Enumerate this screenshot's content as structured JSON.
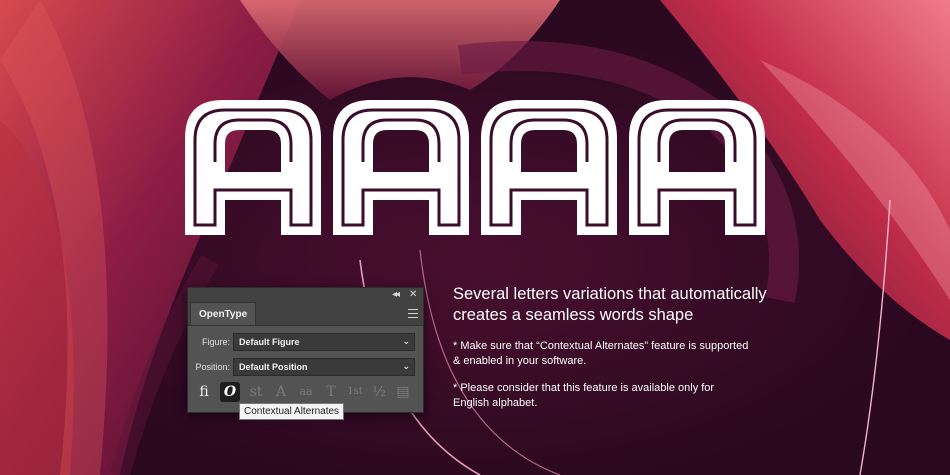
{
  "hero": {
    "letter": "A"
  },
  "panel": {
    "tab_label": "OpenType",
    "collapse_icon": "double-chevron-left-icon",
    "close_icon": "close-icon",
    "menu_icon": "hamburger-menu-icon",
    "figure_label": "Figure:",
    "figure_value": "Default Figure",
    "position_label": "Position:",
    "position_value": "Default Position",
    "feature_icons": [
      {
        "icon": "ligature-icon",
        "glyph": "ﬁ"
      },
      {
        "icon": "contextual-alternates-icon",
        "glyph": "O"
      },
      {
        "icon": "discretionary-ligature-icon",
        "glyph": "st"
      },
      {
        "icon": "swash-icon",
        "glyph": "A"
      },
      {
        "icon": "stylistic-alternates-icon",
        "glyph": "aa"
      },
      {
        "icon": "titling-alternates-icon",
        "glyph": "T"
      },
      {
        "icon": "ordinal-icon",
        "glyph": "1st"
      },
      {
        "icon": "fractions-icon",
        "glyph": "½"
      },
      {
        "icon": "stylistic-sets-icon",
        "glyph": "▤"
      }
    ],
    "tooltip": "Contextual Alternates"
  },
  "copy": {
    "headline_1": "Several letters variations that automatically",
    "headline_2": "creates a seamless words shape",
    "note1_1": "* Make sure that “Contextual Alternates” feature is supported",
    "note1_2": "& enabled in your software.",
    "note2_1": "* Please  consider that this feature is available only for",
    "note2_2": "English alphabet."
  },
  "colors": {
    "background": "#3a0d2a",
    "accent_red": "#c2283a",
    "accent_pink": "#e06a98",
    "panel_bg": "#535353",
    "panel_header": "#424242",
    "text": "#ffffff"
  }
}
